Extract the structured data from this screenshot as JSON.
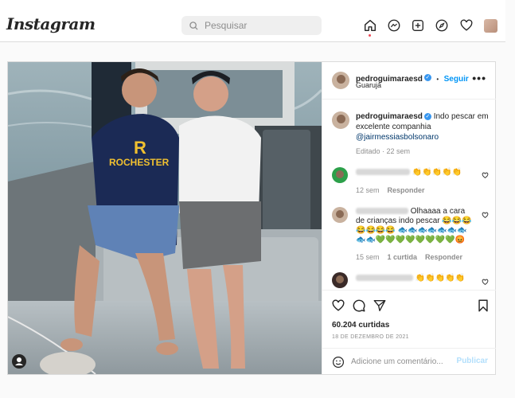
{
  "header": {
    "logo": "Instagram",
    "search_placeholder": "Pesquisar",
    "icons": [
      "home-icon",
      "messenger-icon",
      "new-post-icon",
      "explore-icon",
      "activity-heart-icon",
      "profile-avatar"
    ]
  },
  "post": {
    "username": "pedroguimaraesd",
    "follow_label": "Seguir",
    "separator": "•",
    "location": "Guarujá",
    "more": "•••",
    "caption_user": "pedroguimaraesd",
    "caption_text": "Indo pescar em excelente companhia",
    "caption_mention": "@jairmessiasbolsonaro",
    "edited": "Editado · 22 sem",
    "comments": [
      {
        "text": "👏👏👏👏👏",
        "time": "12 sem",
        "likes": "",
        "reply": "Responder"
      },
      {
        "text": "Olhaaaa a cara de crianças indo pescar 😂😂😂😂😂😂😂 🐟🐟🐟🐟🐟🐟🐟🐟🐟💚💚💚💚💚💚💚💚😡",
        "time": "15 sem",
        "likes": "1 curtida",
        "reply": "Responder"
      },
      {
        "text": "👏👏👏👏👏",
        "time": "",
        "likes": "",
        "reply": ""
      }
    ],
    "likes": "60.204 curtidas",
    "date": "18 DE DEZEMBRO DE 2021",
    "comment_placeholder": "Adicione um comentário...",
    "publish_label": "Publicar"
  },
  "photo": {
    "shirt_left": "ROCHESTER",
    "shirt_left_letter": "R"
  },
  "colors": {
    "accent": "#0095f6",
    "publish_disabled": "#b2dffc",
    "notification": "#ed4956"
  }
}
